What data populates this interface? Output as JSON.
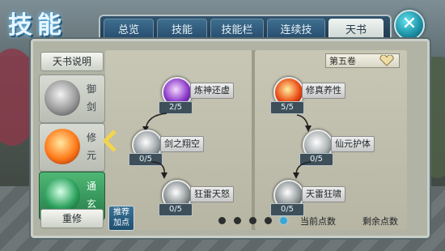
{
  "window": {
    "title": "技能"
  },
  "tabs": [
    {
      "label": "总览",
      "active": false
    },
    {
      "label": "技能",
      "active": false
    },
    {
      "label": "技能栏",
      "active": false
    },
    {
      "label": "连续技",
      "active": false
    },
    {
      "label": "天书",
      "active": true
    }
  ],
  "close_icon": "close-x-icon",
  "sidebar": {
    "intro_label": "天书说明",
    "books": [
      {
        "label": "御剑",
        "emblem": "sword-emblem-icon",
        "active": false
      },
      {
        "label": "修元",
        "emblem": "flame-emblem-icon",
        "active": false
      },
      {
        "label": "通玄",
        "emblem": "jade-emblem-icon",
        "active": true
      }
    ],
    "reset_label": "重修"
  },
  "volume": {
    "label": "第五卷"
  },
  "skills_left": [
    {
      "name": "炼神还虚",
      "count": "2/5"
    },
    {
      "name": "剑之翔空",
      "count": "0/5"
    },
    {
      "name": "狂雷天怒",
      "count": "0/5"
    }
  ],
  "skills_right": [
    {
      "name": "修真养性",
      "count": "5/5"
    },
    {
      "name": "仙元护体",
      "count": "0/5"
    },
    {
      "name": "天雷狂啸",
      "count": "0/5"
    }
  ],
  "recommend": {
    "line1": "推荐",
    "line2": "加点"
  },
  "pagination": {
    "pages": 5,
    "current": 5
  },
  "points": {
    "current_label": "当前点数",
    "remaining_label": "剩余点数"
  },
  "colors": {
    "accent": "#3aa6d6",
    "active_book": "#257b49",
    "panel": "#b1b3a4"
  }
}
